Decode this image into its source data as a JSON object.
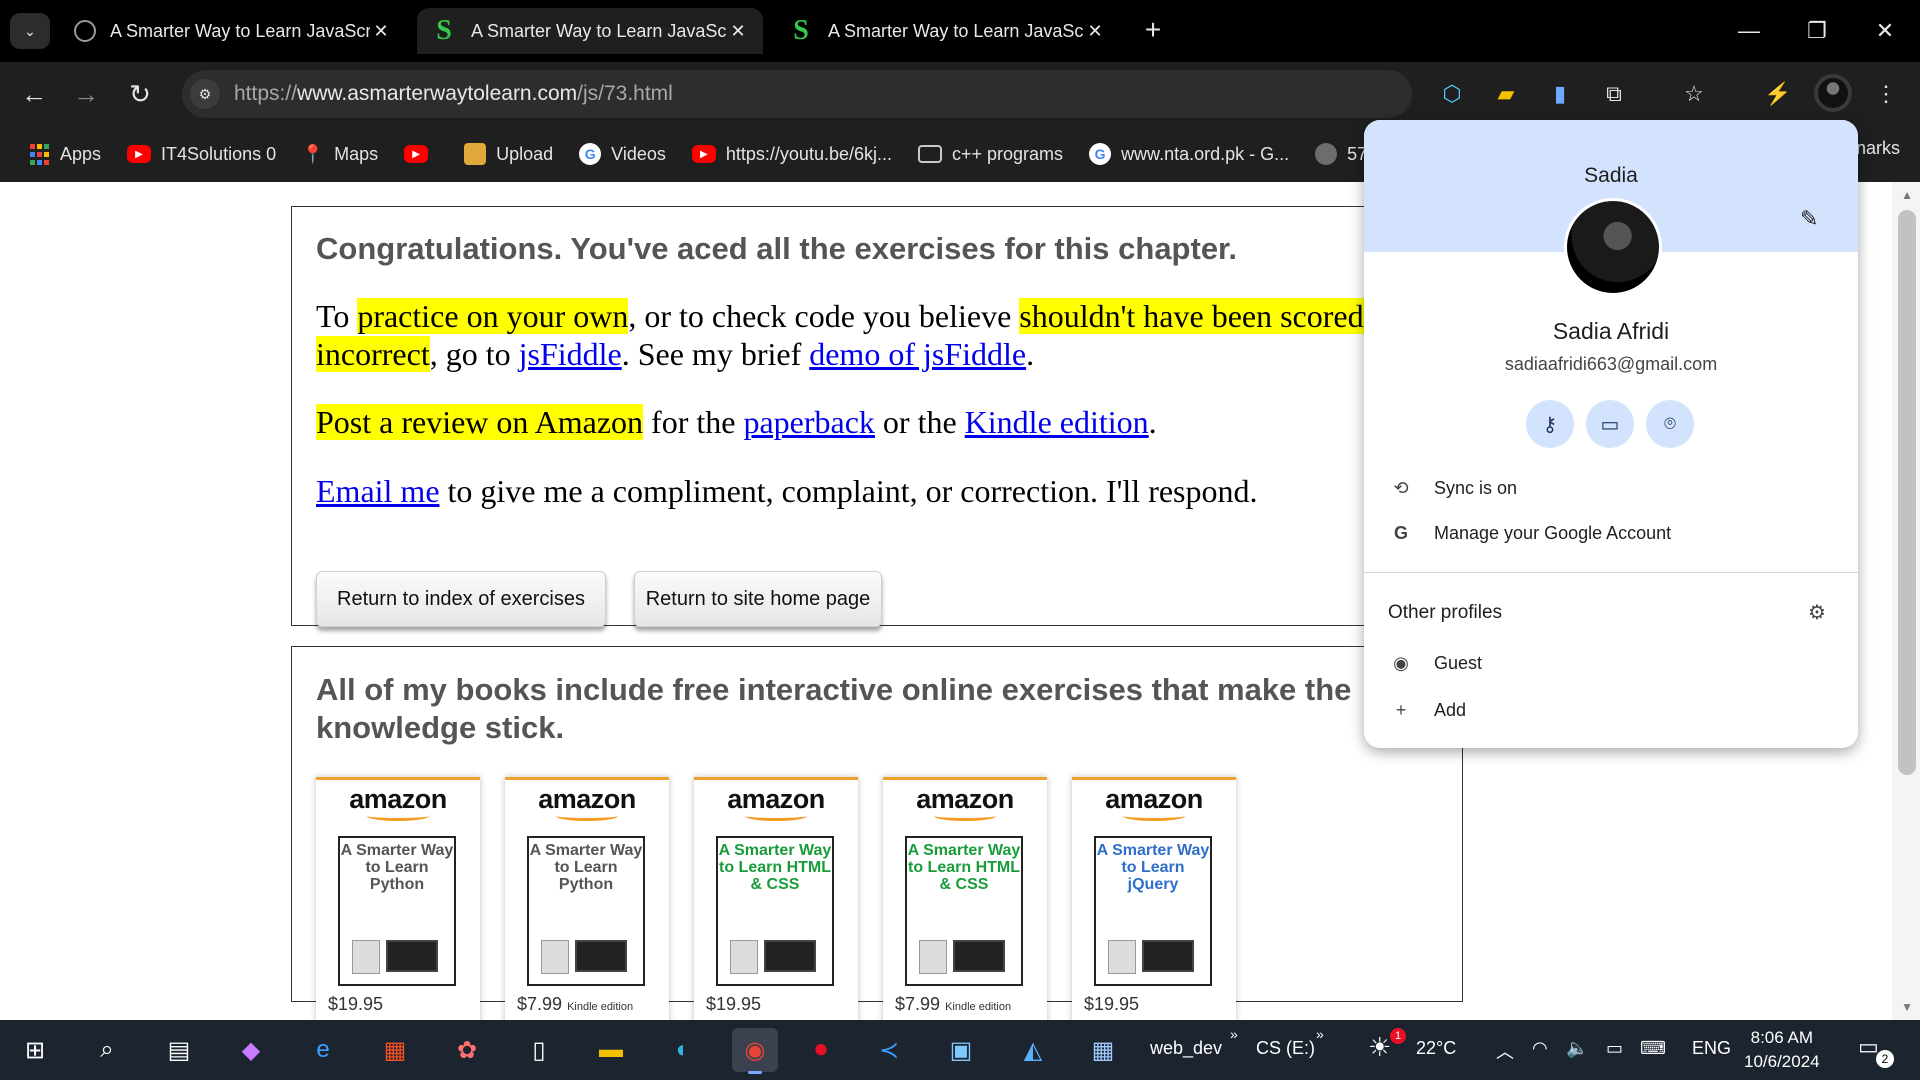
{
  "browser": {
    "tabs": [
      {
        "title": "A Smarter Way to Learn JavaScr",
        "favicon": "globe-icon",
        "active": false
      },
      {
        "title": "A Smarter Way to Learn JavaScr",
        "favicon": "s-logo-icon",
        "active": true
      },
      {
        "title": "A Smarter Way to Learn JavaScr",
        "favicon": "s-logo-icon",
        "active": false
      }
    ],
    "favicon_s": "S",
    "new_tab": "+",
    "close_glyph": "✕",
    "url_prefix": "https://",
    "url_host": "www.asmarterwaytolearn.com",
    "url_path": "/js/73.html"
  },
  "bookmarks": [
    {
      "label": "Apps",
      "icon": "apps-grid-icon"
    },
    {
      "label": "IT4Solutions 0",
      "icon": "youtube-icon"
    },
    {
      "label": "Maps",
      "icon": "maps-pin-icon"
    },
    {
      "label": "",
      "icon": "youtube-icon"
    },
    {
      "label": "Upload",
      "icon": "package-icon"
    },
    {
      "label": "Videos",
      "icon": "google-icon"
    },
    {
      "label": "https://youtu.be/6kj...",
      "icon": "youtube-icon"
    },
    {
      "label": "c++ programs",
      "icon": "folder-icon"
    },
    {
      "label": "www.nta.ord.pk - G...",
      "icon": "google-icon"
    },
    {
      "label": "579",
      "icon": "globe-icon"
    }
  ],
  "bookmarks_overflow": "narks",
  "page": {
    "congrats": "Congratulations. You've aced all the exercises for this chapter.",
    "p1": {
      "t1": "To ",
      "h1": "practice on your own",
      "t2": ", or to check code you believe ",
      "h2": "shouldn't have been scored as incorrect",
      "t3": ", go to ",
      "link1": "jsFiddle",
      "t4": ". See my brief ",
      "link2": "demo of jsFiddle",
      "t5": "."
    },
    "p2": {
      "h1": "Post a review on Amazon",
      "t1": " for the ",
      "link1": "paperback",
      "t2": " or the ",
      "link2": "Kindle edition",
      "t3": "."
    },
    "p3": {
      "link1": "Email me",
      "t1": " to give me a compliment, complaint, or correction. I'll respond."
    },
    "btn_index": "Return to index of exercises",
    "btn_home": "Return to site home page",
    "books_head": "All of my books include free interactive online exercises that make the knowledge stick.",
    "books": [
      {
        "title": "A Smarter Way to Learn Python",
        "price": "$19.95",
        "edition": "",
        "color": "#555555"
      },
      {
        "title": "A Smarter Way to Learn Python",
        "price": "$7.99",
        "edition": "Kindle edition",
        "color": "#555555"
      },
      {
        "title": "A Smarter Way to Learn HTML & CSS",
        "price": "$19.95",
        "edition": "",
        "color": "#1a9c3a"
      },
      {
        "title": "A Smarter Way to Learn HTML & CSS",
        "price": "$7.99",
        "edition": "Kindle edition",
        "color": "#1a9c3a"
      },
      {
        "title": "A Smarter Way to Learn jQuery",
        "price": "$19.95",
        "edition": "",
        "color": "#2f6fc9"
      }
    ],
    "amazon_label": "amazon"
  },
  "profile": {
    "header_name": "Sadia",
    "full_name": "Sadia Afridi",
    "email": "sadiaafridi663@gmail.com",
    "sync": "Sync is on",
    "manage": "Manage your Google Account",
    "other_profiles": "Other profiles",
    "guest": "Guest",
    "add": "Add"
  },
  "taskbar": {
    "web_dev": "web_dev",
    "drive": "CS (E:)",
    "temp": "22°C",
    "lang": "ENG",
    "time": "8:06 AM",
    "date": "10/6/2024",
    "weather_badge": "1",
    "notif_count": "2"
  },
  "colors": {
    "highlight": "#ffff00",
    "link": "#0000ee",
    "profile_header": "#d3e3fd",
    "chrome_dark": "#1f1f1f"
  }
}
